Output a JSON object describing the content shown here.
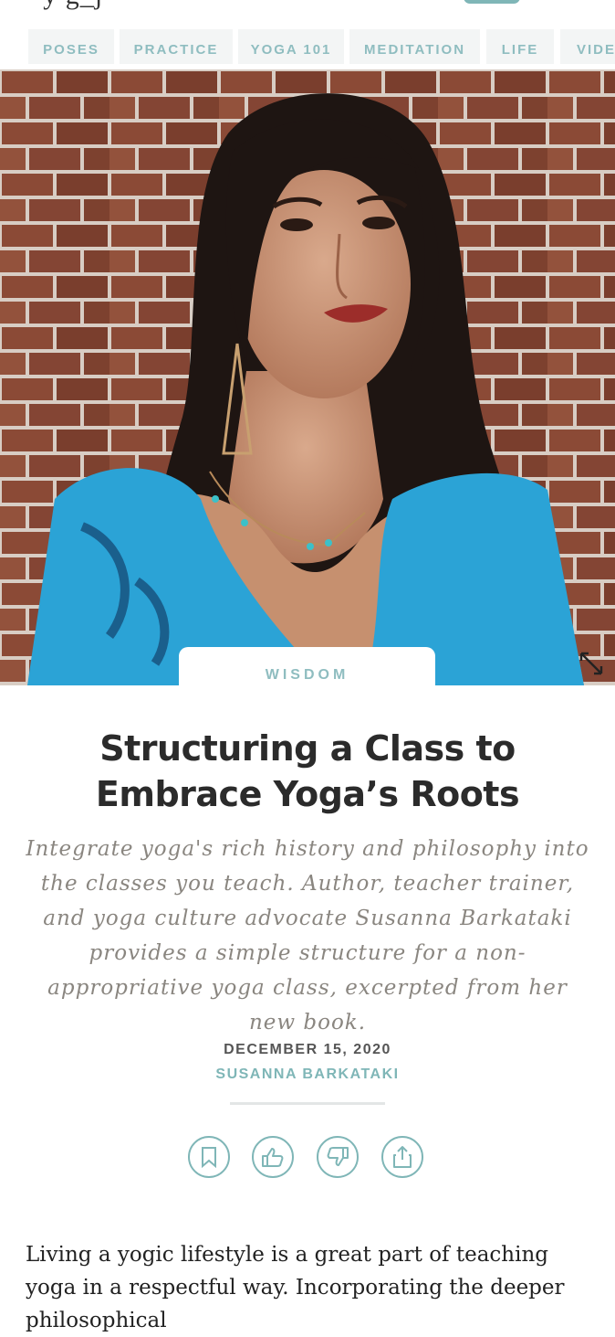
{
  "nav": {
    "tabs": [
      "POSES",
      "PRACTICE",
      "YOGA 101",
      "MEDITATION",
      "LIFE",
      "VIDE"
    ]
  },
  "article": {
    "category": "WISDOM",
    "title": "Structuring a Class to Embrace Yoga’s Roots",
    "dek": "Integrate yoga's rich history and philosophy into the classes you teach. Author, teacher trainer, and yoga culture advocate Susanna Barkataki provides a simple structure for a non-appropriative yoga class, excerpted from her new book.",
    "date": "DECEMBER 15, 2020",
    "author": "SUSANNA BARKATAKI",
    "body_start": "Living a yogic lifestyle is a great part of teaching yoga in a respectful way. Incorporating the deeper philosophical"
  },
  "actions": [
    "bookmark-icon",
    "thumbs-up-icon",
    "thumbs-down-icon",
    "share-icon"
  ],
  "colors": {
    "accent": "#7fb6b7",
    "tab_bg": "#f3f5f5",
    "title": "#2b2b2b",
    "dek": "#8a8680"
  }
}
